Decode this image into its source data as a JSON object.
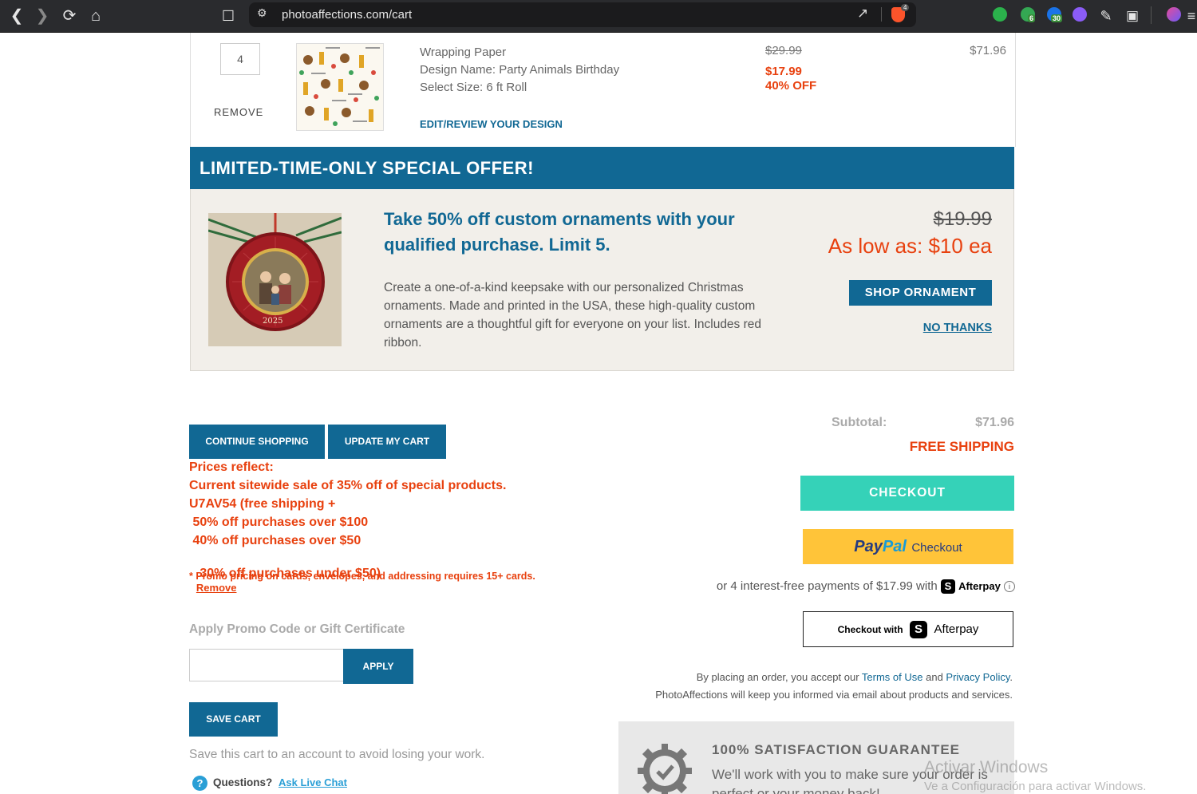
{
  "browser": {
    "url": "photoaffections.com/cart",
    "ext_badge_1": "6",
    "ext_badge_2": "30",
    "brave_badge": "4"
  },
  "cart_item": {
    "quantity": "4",
    "remove_label": "REMOVE",
    "product_name": "Wrapping Paper",
    "design_name": "Design Name: Party Animals Birthday",
    "size": "Select Size: 6 ft Roll",
    "edit_link": "EDIT/REVIEW YOUR DESIGN",
    "original_price": "$29.99",
    "sale_price": "$17.99",
    "discount": "40% OFF",
    "line_total": "$71.96"
  },
  "offer": {
    "banner": "LIMITED-TIME-ONLY SPECIAL OFFER!",
    "headline": "Take 50% off custom ornaments with your qualified purchase. Limit 5.",
    "ornament_year": "2025",
    "description": "Create a one-of-a-kind keepsake with our personalized Christmas ornaments. Made and printed in the USA, these high-quality custom ornaments are a thoughtful gift for everyone on your list. Includes red ribbon.",
    "original_price": "$19.99",
    "low_price": "As low as: $10 ea",
    "shop_button": "SHOP ORNAMENT",
    "no_thanks": "NO THANKS"
  },
  "actions": {
    "continue_shopping": "CONTINUE SHOPPING",
    "update_cart": "UPDATE MY CART",
    "save_cart": "SAVE CART",
    "save_cart_note": "Save this cart to an account to avoid losing your work."
  },
  "promo": {
    "line1": "Prices reflect:",
    "line2": "Current sitewide sale of 35% off of special products.",
    "line3": "U7AV54 (free shipping +",
    "line4": " 50% off purchases over $100",
    "line5": " 40% off purchases over $50",
    "line6": " 30% off purchases under $50)",
    "remove_link": "Remove",
    "footnote": "* Promo pricing on cards, envelopes, and addressing requires 15+ cards.",
    "code_label": "Apply Promo Code or Gift Certificate",
    "code_value": "",
    "apply_button": "APPLY"
  },
  "summary": {
    "subtotal_label": "Subtotal:",
    "subtotal_value": "$71.96",
    "shipping": "FREE SHIPPING",
    "checkout_button": "CHECKOUT",
    "paypal_pay": "Pay",
    "paypal_pal": "Pal",
    "paypal_checkout": "Checkout",
    "afterpay_note": "or 4 interest-free payments of $17.99 with",
    "afterpay_brand": "Afterpay",
    "afterpay_info": "i",
    "checkout_with": "Checkout with",
    "afterpay_logo_text": "Afterpay",
    "legal_prefix": "By placing an order, you accept our ",
    "terms_link": "Terms of Use",
    "legal_and": " and ",
    "privacy_link": "Privacy Policy",
    "legal_period": ".",
    "legal_line2": "PhotoAffections will keep you informed via email about products and services."
  },
  "guarantee": {
    "title": "100% SATISFACTION GUARANTEE",
    "text": "We'll work with you to make sure your order is perfect or your money back!"
  },
  "help": {
    "questions": "Questions?",
    "live_chat": "Ask Live Chat"
  },
  "watermark": {
    "line1": "Activar Windows",
    "line2": "Ve a Configuración para activar Windows."
  },
  "colors": {
    "brand_blue": "#116894",
    "sale_red": "#e8410f",
    "checkout_teal": "#35d2b8",
    "paypal_yellow": "#ffc439"
  }
}
